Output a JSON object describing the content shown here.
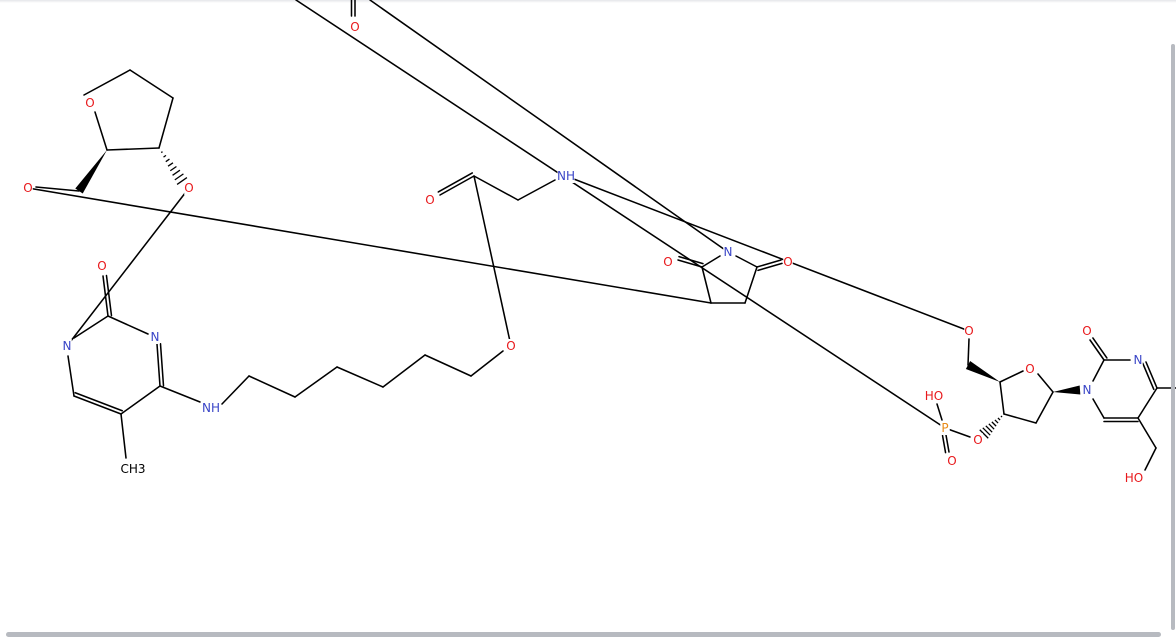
{
  "viewer": {
    "scrollbars": [
      "horizontal",
      "vertical"
    ]
  },
  "colors": {
    "bond": "#000000",
    "oxygen": "#e8191c",
    "nitrogen": "#3a45c7",
    "phosphorus": "#e78a17",
    "carbon_label": "#000000"
  },
  "atoms": [
    {
      "id": "o_top",
      "label": "O",
      "element": "O"
    },
    {
      "id": "o_thf_ring",
      "label": "O",
      "element": "O"
    },
    {
      "id": "o_left",
      "label": "O",
      "element": "O"
    },
    {
      "id": "o_thf_sub",
      "label": "O",
      "element": "O"
    },
    {
      "id": "o_amide",
      "label": "O",
      "element": "O"
    },
    {
      "id": "nh_amide",
      "label": "NH",
      "element": "N"
    },
    {
      "id": "n_imide",
      "label": "N",
      "element": "N"
    },
    {
      "id": "o_imide_l",
      "label": "O",
      "element": "O"
    },
    {
      "id": "o_imide_r",
      "label": "O",
      "element": "O"
    },
    {
      "id": "o_pyr_co",
      "label": "O",
      "element": "O"
    },
    {
      "id": "n_pyr3",
      "label": "N",
      "element": "N"
    },
    {
      "id": "n_pyr1",
      "label": "N",
      "element": "N"
    },
    {
      "id": "o_linker",
      "label": "O",
      "element": "O"
    },
    {
      "id": "nh_pyr",
      "label": "NH",
      "element": "N"
    },
    {
      "id": "ch3",
      "label": "CH3",
      "element": "C"
    },
    {
      "id": "o_5prime",
      "label": "O",
      "element": "O"
    },
    {
      "id": "o_sugar_ring",
      "label": "O",
      "element": "O"
    },
    {
      "id": "o_uracil_co",
      "label": "O",
      "element": "O"
    },
    {
      "id": "n_ura3",
      "label": "N",
      "element": "N"
    },
    {
      "id": "n_ura1",
      "label": "N",
      "element": "N"
    },
    {
      "id": "oh_phos",
      "label": "HO",
      "element": "O"
    },
    {
      "id": "p",
      "label": "P",
      "element": "P"
    },
    {
      "id": "o_3prime",
      "label": "O",
      "element": "O"
    },
    {
      "id": "o_phos_dbl",
      "label": "O",
      "element": "O"
    },
    {
      "id": "oh_ch2",
      "label": "HO",
      "element": "O"
    }
  ]
}
